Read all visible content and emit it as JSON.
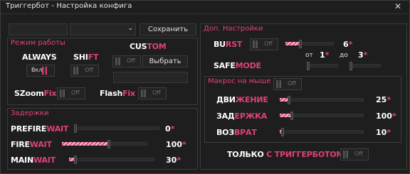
{
  "window": {
    "title": "Триггербот - Настройка конфига",
    "close_glyph": "✕"
  },
  "top": {
    "config_name_value": "",
    "config_combo_value": "",
    "combo_arrow": "⌄",
    "save_label": "Сохранить"
  },
  "modes": {
    "section": "Режим работы",
    "always": {
      "a": "ALWAYS",
      "b": ""
    },
    "always_toggle": "Вкл",
    "shift": {
      "a": "SHI",
      "b": "FT"
    },
    "shift_toggle": "Off",
    "custom": {
      "a": "CUS",
      "b": "TOM"
    },
    "custom_toggle": "Off",
    "choose_label": "Выбрать",
    "custom_key_value": "",
    "szoom": {
      "a": "SZoom",
      "b": "Fix"
    },
    "szoom_toggle": "Off",
    "flash": {
      "a": "Flash",
      "b": "Fix"
    },
    "flash_toggle": "Off"
  },
  "delays": {
    "section": "Задержки",
    "prefire": {
      "a": "PREFIRE",
      "b": "WAIT",
      "value": "0",
      "unit": "*",
      "level": 0
    },
    "fire": {
      "a": "FIRE",
      "b": "WAIT",
      "value": "100",
      "unit": "*",
      "level": 0.55
    },
    "main": {
      "a": "MAIN",
      "b": "WAIT",
      "value": "30",
      "unit": "*",
      "level": 0.06
    }
  },
  "extra": {
    "section": "Доп. Настройки",
    "burst": {
      "a": "BU",
      "b": "RST",
      "toggle": "Off",
      "value": "6",
      "unit": "*",
      "level": 0.3
    },
    "from_label": "от",
    "to_label": "до",
    "burst_min": {
      "value": "1",
      "unit": "*",
      "level": 0
    },
    "burst_max": {
      "value": "3",
      "unit": "*",
      "level": 0
    },
    "safemode": {
      "a": "SAFE",
      "b": "MODE",
      "level": 0
    }
  },
  "mouse": {
    "section": "Макрос на мыше",
    "toggle": "Off",
    "move": {
      "a": "ДВИ",
      "b": "ЖЕНИЕ",
      "value": "25",
      "unit": "*",
      "level": 0.1
    },
    "delay": {
      "a": "ЗАД",
      "b": "ЕРЖКА",
      "value": "100",
      "unit": "*",
      "level": 0.13
    },
    "return": {
      "a": "ВОЗ",
      "b": "ВРАТ",
      "value": "10",
      "unit": "*",
      "level": 0.02
    },
    "only": {
      "a": "ТОЛЬКО",
      "b": " С ТРИГГЕРБОТОМ"
    },
    "only_toggle": "Off"
  },
  "colors": {
    "accent": "#e0417a",
    "background": "#1e1e1e",
    "border": "#3b3b3b"
  }
}
